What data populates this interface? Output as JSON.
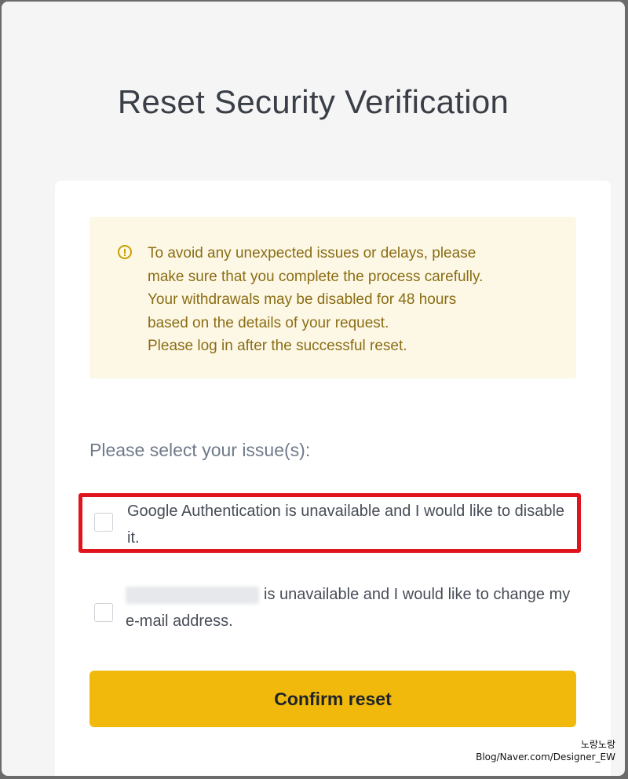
{
  "page": {
    "title": "Reset Security Verification"
  },
  "notice": {
    "icon": "alert-circle-icon",
    "lines": [
      "To avoid any unexpected issues or delays, please",
      "make sure that you complete the process carefully.",
      "Your withdrawals may be disabled for 48 hours",
      "based on the details of your request.",
      "Please log in after the successful reset."
    ]
  },
  "form": {
    "select_label": "Please select your issue(s):",
    "options": [
      {
        "label": "Google Authentication is unavailable and I would like to disable it.",
        "checked": false,
        "highlighted": true
      },
      {
        "label_suffix": "is unavailable and I would like to change my e-mail address.",
        "checked": false,
        "masked_email": true
      }
    ],
    "confirm_label": "Confirm reset"
  },
  "watermark": {
    "line1": "노랑노랑",
    "line2": "Blog/Naver.com/Designer_EW"
  },
  "colors": {
    "accent": "#f0b90b",
    "notice_bg": "#fdf8e6",
    "notice_text": "#8a6d14",
    "highlight_border": "#e0141c"
  }
}
